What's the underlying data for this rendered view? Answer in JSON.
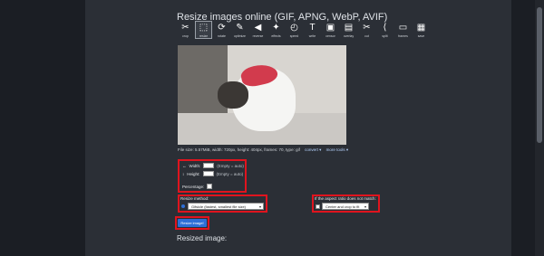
{
  "page": {
    "title": "Resize images online (GIF, APNG, WebP, AVIF)"
  },
  "toolbar": [
    {
      "name": "crop",
      "label": "crop",
      "icon": "crop-icon",
      "glyph": "✂"
    },
    {
      "name": "resize",
      "label": "resize",
      "icon": "resize-icon",
      "glyph": "⬚"
    },
    {
      "name": "rotate",
      "label": "rotate",
      "icon": "rotate-icon",
      "glyph": "⟳"
    },
    {
      "name": "optimize",
      "label": "optimize",
      "icon": "optimize-icon",
      "glyph": "✎"
    },
    {
      "name": "reverse",
      "label": "reverse",
      "icon": "reverse-icon",
      "glyph": "◀"
    },
    {
      "name": "effects",
      "label": "effects",
      "icon": "effects-icon",
      "glyph": "✦"
    },
    {
      "name": "speed",
      "label": "speed",
      "icon": "speed-icon",
      "glyph": "◴"
    },
    {
      "name": "write",
      "label": "write",
      "icon": "write-icon",
      "glyph": "T"
    },
    {
      "name": "censor",
      "label": "censor",
      "icon": "censor-icon",
      "glyph": "▣"
    },
    {
      "name": "overlay",
      "label": "overlay",
      "icon": "overlay-icon",
      "glyph": "▤"
    },
    {
      "name": "cut",
      "label": "cut",
      "icon": "scissors-icon",
      "glyph": "✂"
    },
    {
      "name": "split",
      "label": "split",
      "icon": "split-icon",
      "glyph": "⟨"
    },
    {
      "name": "frames",
      "label": "frames",
      "icon": "frames-icon",
      "glyph": "▭"
    },
    {
      "name": "save",
      "label": "save",
      "icon": "save-icon",
      "glyph": "▦"
    }
  ],
  "file_info": {
    "text": "File size: 5.57MiB, width: 720px, height: 404px, frames: 70, type: gif",
    "convert": "convert ▾",
    "more_tools": "more tools ▾"
  },
  "dimensions": {
    "width_label": "Width:",
    "width_hint": "(Empty = auto)",
    "height_label": "Height:",
    "height_hint": "(Empty = auto)",
    "percentage_label": "Percentage:"
  },
  "resize_method": {
    "label": "Resize method:",
    "value": "Gifsicle (fastest, smallest file size)"
  },
  "aspect": {
    "label": "If the aspect ratio does not match:",
    "value": "Center and crop to fit"
  },
  "actions": {
    "resize_button": "Resize image!"
  },
  "result": {
    "heading": "Resized image:"
  },
  "colors": {
    "accent": "#2d6fd6",
    "highlight": "#e0141e",
    "background": "#2b2f36"
  }
}
